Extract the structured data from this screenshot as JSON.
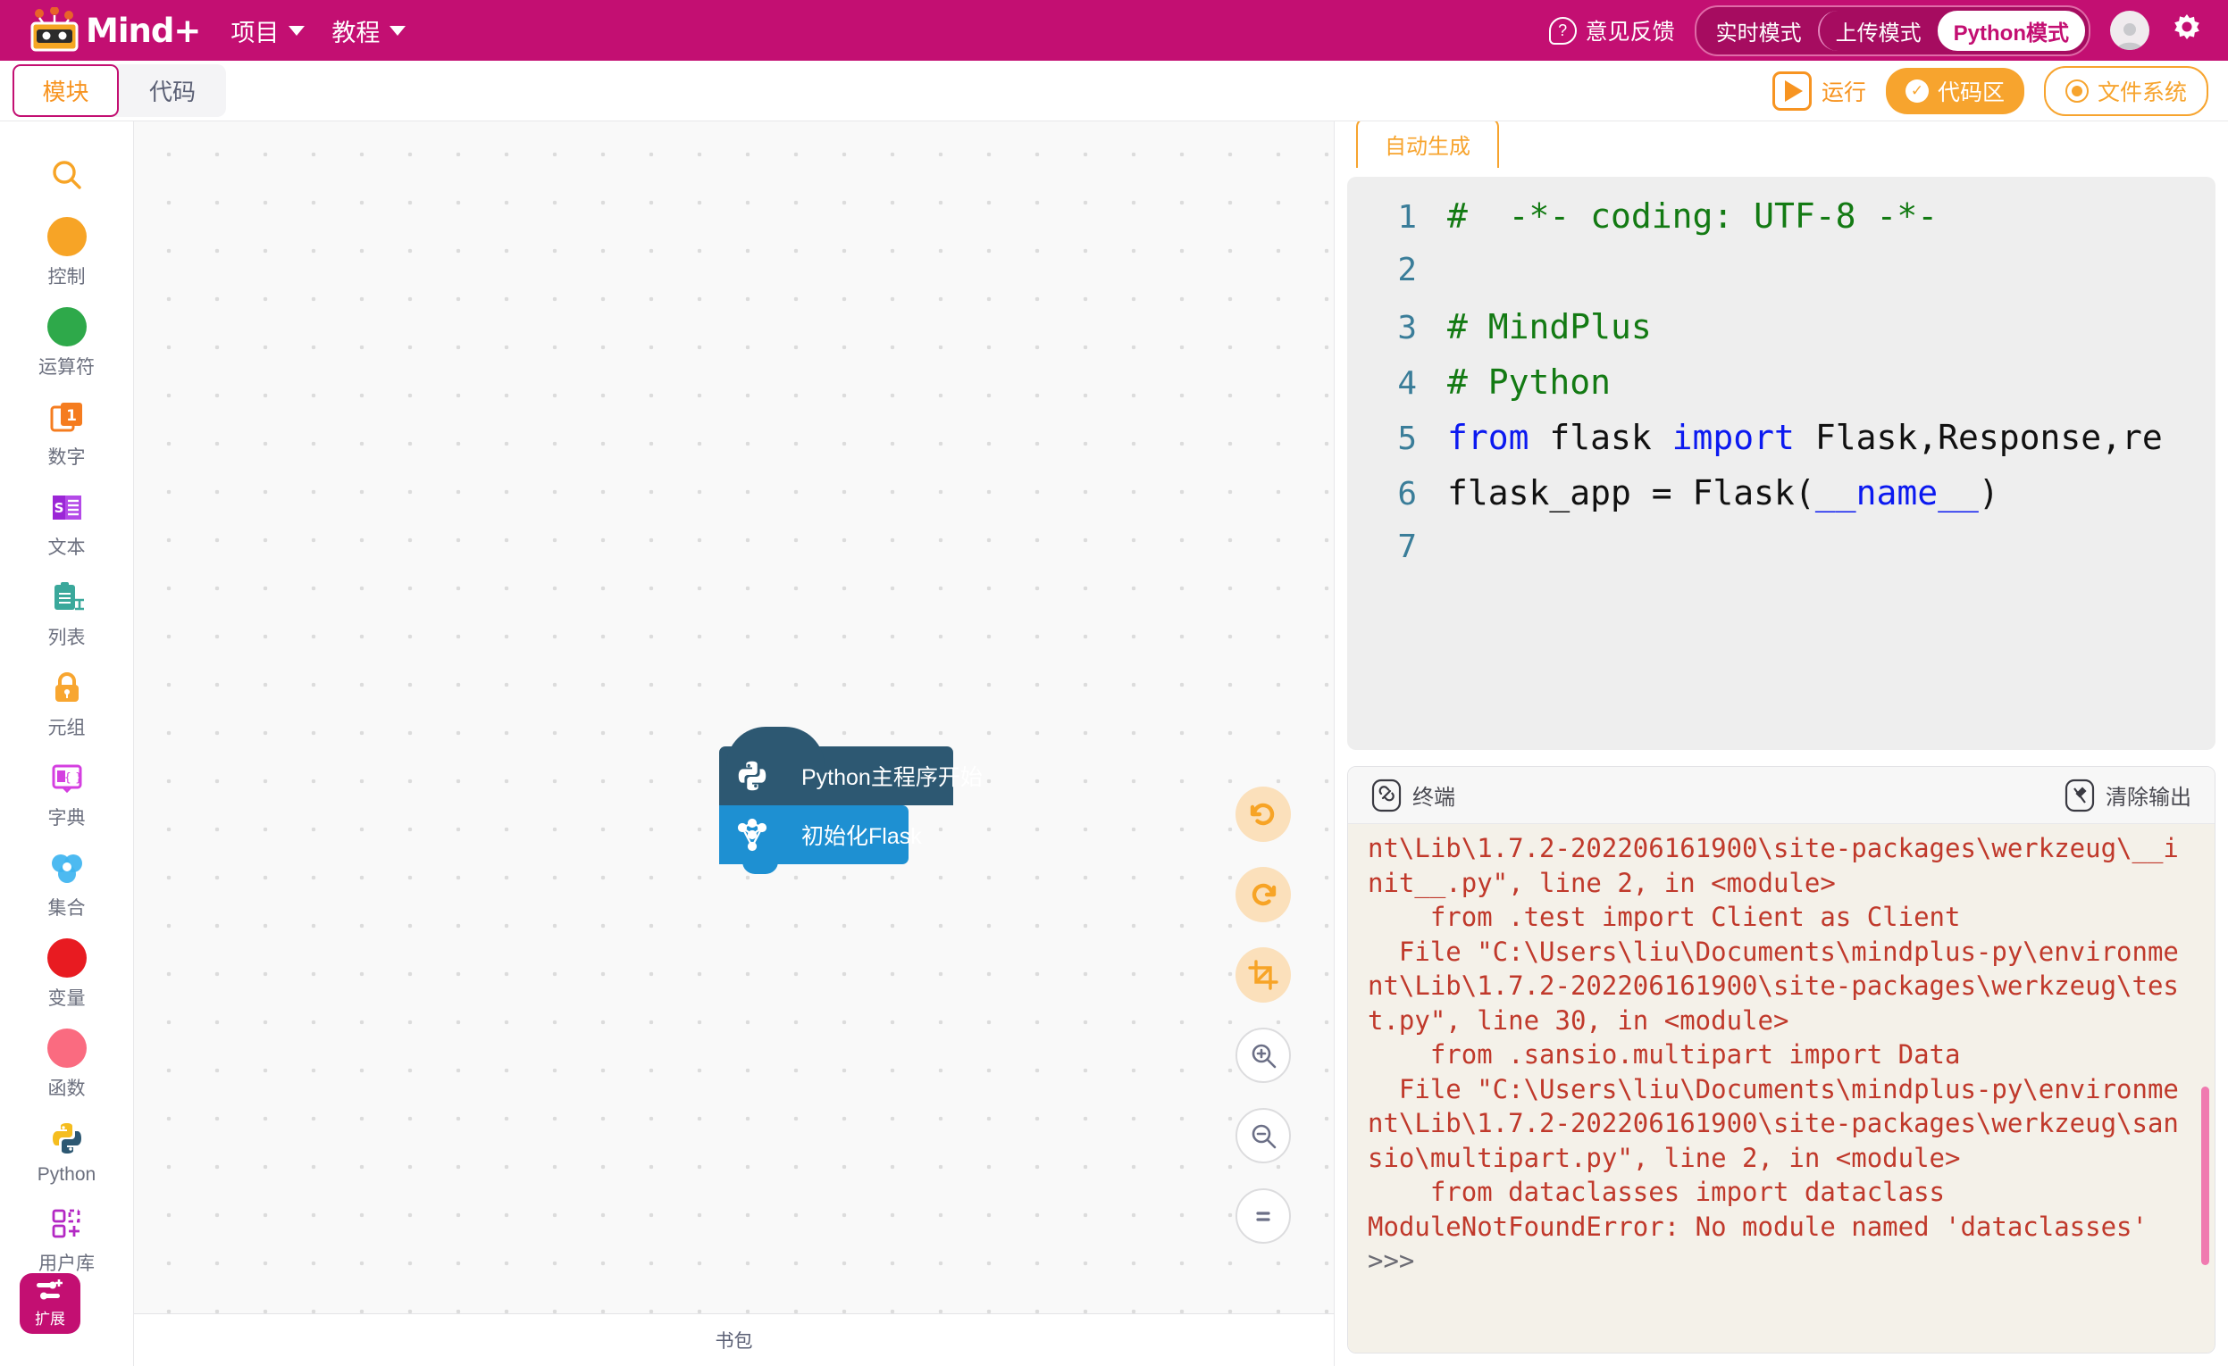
{
  "topbar": {
    "brand": "Mind+",
    "logo_icon": "mindplus-robot-logo",
    "menus": [
      {
        "label": "项目",
        "icon": "chevron-down-icon"
      },
      {
        "label": "教程",
        "icon": "chevron-down-icon"
      }
    ],
    "feedback": {
      "label": "意见反馈",
      "icon": "question-mark-icon"
    },
    "modes": [
      {
        "label": "实时模式",
        "active": false
      },
      {
        "label": "上传模式",
        "active": false
      },
      {
        "label": "Python模式",
        "active": true
      }
    ],
    "avatar_icon": "user-avatar",
    "settings_icon": "gear-icon",
    "accent": "#c30f72"
  },
  "subbar": {
    "tabs": [
      {
        "label": "模块",
        "active": true
      },
      {
        "label": "代码",
        "active": false
      }
    ],
    "run": {
      "label": "运行",
      "icon": "play-icon"
    },
    "code_area": {
      "label": "代码区",
      "icon": "check-circle-icon",
      "active": true
    },
    "file_system": {
      "label": "文件系统",
      "icon": "radio-dot-icon",
      "active": false
    },
    "accent": "#f7a42e"
  },
  "palette": {
    "search_icon": "search-icon",
    "categories": [
      {
        "label": "控制",
        "icon": "orange-circle-icon",
        "color": "#f7a426"
      },
      {
        "label": "运算符",
        "icon": "green-circle-icon",
        "color": "#2ea94a"
      },
      {
        "label": "数字",
        "icon": "number-card-icon",
        "color": "#f57c1f"
      },
      {
        "label": "文本",
        "icon": "text-doc-icon",
        "color": "#9b26d6"
      },
      {
        "label": "列表",
        "icon": "list-clipboard-icon",
        "color": "#3aa89b"
      },
      {
        "label": "元组",
        "icon": "lock-icon",
        "color": "#f8a630"
      },
      {
        "label": "字典",
        "icon": "dictionary-book-icon",
        "color": "#d43fe0"
      },
      {
        "label": "集合",
        "icon": "venn-set-icon",
        "color": "#3eb4f0"
      },
      {
        "label": "变量",
        "icon": "red-circle-icon",
        "color": "#e81b21"
      },
      {
        "label": "函数",
        "icon": "pink-circle-icon",
        "color": "#fa6b80"
      },
      {
        "label": "Python",
        "icon": "python-logo-icon",
        "color": "#f5bd1f"
      },
      {
        "label": "用户库",
        "icon": "user-library-icon",
        "color": "#b328c4"
      }
    ],
    "extension": {
      "label": "扩展",
      "icon": "extension-icon"
    }
  },
  "canvas": {
    "blocks": [
      {
        "label": "Python主程序开始",
        "icon": "python-logo-icon",
        "color": "#2d5872"
      },
      {
        "label": "初始化Flask",
        "icon": "flask-node-icon",
        "color": "#1e90d2"
      }
    ],
    "controls": [
      {
        "name": "undo",
        "icon": "undo-icon"
      },
      {
        "name": "redo",
        "icon": "redo-icon"
      },
      {
        "name": "fit",
        "icon": "crop-fit-icon"
      },
      {
        "name": "zoom-in",
        "icon": "zoom-in-icon"
      },
      {
        "name": "zoom-out",
        "icon": "zoom-out-icon"
      },
      {
        "name": "zoom-reset",
        "icon": "equals-icon"
      }
    ],
    "backpack_label": "书包"
  },
  "code_panel": {
    "tab_label": "自动生成",
    "lines": [
      {
        "num": "1",
        "segments": [
          {
            "t": "#  -*- coding: UTF-8 -*-",
            "c": "cm"
          }
        ]
      },
      {
        "num": "2",
        "segments": [
          {
            "t": "",
            "c": "ctext"
          }
        ]
      },
      {
        "num": "3",
        "segments": [
          {
            "t": "# MindPlus",
            "c": "cm"
          }
        ]
      },
      {
        "num": "4",
        "segments": [
          {
            "t": "# Python",
            "c": "cm"
          }
        ]
      },
      {
        "num": "5",
        "segments": [
          {
            "t": "from",
            "c": "kw"
          },
          {
            "t": " flask ",
            "c": "ctext"
          },
          {
            "t": "import",
            "c": "kw"
          },
          {
            "t": " Flask,Response,re",
            "c": "ctext"
          }
        ]
      },
      {
        "num": "6",
        "segments": [
          {
            "t": "flask_app = Flask(",
            "c": "ctext"
          },
          {
            "t": "__name__",
            "c": "kw"
          },
          {
            "t": ")",
            "c": "ctext"
          }
        ]
      },
      {
        "num": "7",
        "segments": [
          {
            "t": "",
            "c": "ctext"
          }
        ]
      }
    ]
  },
  "terminal": {
    "title": "终端",
    "title_icon": "link-icon",
    "clear_label": "清除输出",
    "clear_icon": "clear-output-icon",
    "output": [
      "nt\\Lib\\1.7.2-202206161900\\site-packages\\werkzeug\\__i",
      "nit__.py\", line 2, in <module>",
      "    from .test import Client as Client",
      "  File \"C:\\Users\\liu\\Documents\\mindplus-py\\environme",
      "nt\\Lib\\1.7.2-202206161900\\site-packages\\werkzeug\\tes",
      "t.py\", line 30, in <module>",
      "    from .sansio.multipart import Data",
      "  File \"C:\\Users\\liu\\Documents\\mindplus-py\\environme",
      "nt\\Lib\\1.7.2-202206161900\\site-packages\\werkzeug\\san",
      "sio\\multipart.py\", line 2, in <module>",
      "    from dataclasses import dataclass",
      "ModuleNotFoundError: No module named 'dataclasses'"
    ],
    "prompt": ">>>"
  }
}
